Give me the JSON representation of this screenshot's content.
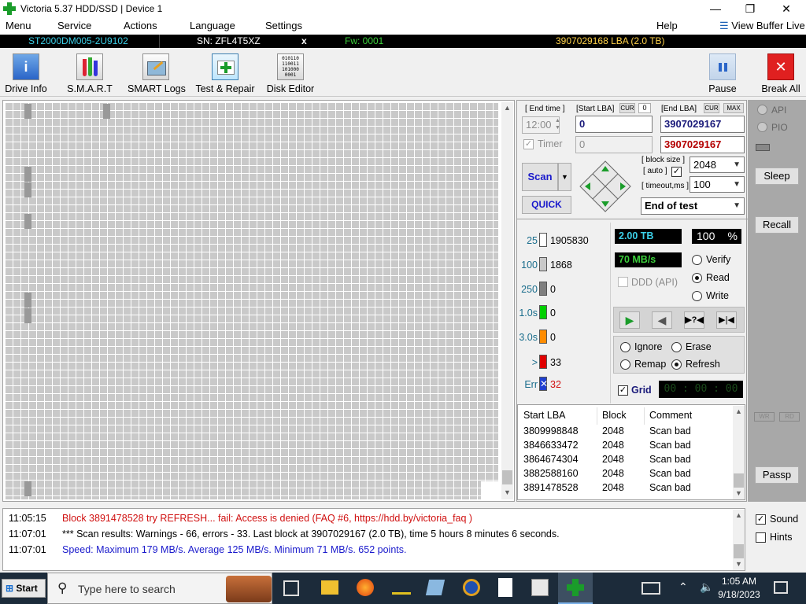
{
  "window": {
    "title": "Victoria 5.37 HDD/SSD | Device 1",
    "controls": {
      "minimize": "—",
      "maximize": "❐",
      "close": "✕"
    }
  },
  "menu": {
    "items": [
      "Menu",
      "Service",
      "Actions",
      "Language",
      "Settings"
    ],
    "help": "Help",
    "view_buffer": "View Buffer Live"
  },
  "drive_strip": {
    "model": "ST2000DM005-2U9102",
    "serial": "SN: ZFL4T5XZ",
    "close": "x",
    "firmware": "Fw: 0001",
    "capacity": "3907029168 LBA (2.0 TB)"
  },
  "toolbar": {
    "drive_info": "Drive Info",
    "smart": "S.M.A.R.T",
    "smart_logs": "SMART Logs",
    "test_repair": "Test & Repair",
    "disk_editor": "Disk Editor",
    "pause": "Pause",
    "break_all": "Break All"
  },
  "scan": {
    "end_time_label": "[ End time ]",
    "end_time_value": "12:00",
    "start_lba_label": "[Start LBA]",
    "cur_label": "CUR",
    "start_cur_value": "0",
    "end_lba_label": "[End LBA]",
    "max_label": "MAX",
    "start_lba_value": "0",
    "end_lba_value": "3907029167",
    "timer_label": "Timer",
    "timer_value": "0",
    "end_lba_value2": "3907029167",
    "block_size_label": "[ block size ]",
    "auto_label": "[ auto ]",
    "block_size_value": "2048",
    "timeout_label": "[ timeout,ms ]",
    "timeout_value": "100",
    "scan_button": "Scan",
    "quick_button": "QUICK",
    "end_action": "End of test"
  },
  "stats": {
    "rows": [
      {
        "label": "25",
        "value": "1905830",
        "color": "#ffffff"
      },
      {
        "label": "100",
        "value": "1868",
        "color": "#c8c8c8"
      },
      {
        "label": "250",
        "value": "0",
        "color": "#7f7f7f"
      },
      {
        "label": "1.0s",
        "value": "0",
        "color": "#00d000"
      },
      {
        "label": "3.0s",
        "value": "0",
        "color": "#ff8c00"
      },
      {
        "label": ">",
        "value": "33",
        "color": "#e00000"
      },
      {
        "label": "Err",
        "value": "32",
        "color": "#1f3fd0"
      }
    ],
    "size_display": "2.00 TB",
    "percent": "100",
    "percent_sign": "%",
    "speed_display": "70 MB/s",
    "ddd_label": "DDD (API)"
  },
  "mode": {
    "verify": "Verify",
    "read": "Read",
    "write": "Write",
    "selected": "Read"
  },
  "repair": {
    "ignore": "Ignore",
    "erase": "Erase",
    "remap": "Remap",
    "refresh": "Refresh",
    "selected": "Refresh"
  },
  "grid_option": {
    "label": "Grid",
    "timer": "00 : 00 : 00"
  },
  "table": {
    "headers": [
      "Start LBA",
      "Block",
      "Comment"
    ],
    "rows": [
      [
        "3809998848",
        "2048",
        "Scan bad"
      ],
      [
        "3846633472",
        "2048",
        "Scan bad"
      ],
      [
        "3864674304",
        "2048",
        "Scan bad"
      ],
      [
        "3882588160",
        "2048",
        "Scan bad"
      ],
      [
        "3891478528",
        "2048",
        "Scan bad"
      ]
    ]
  },
  "side": {
    "api": "API",
    "pio": "PIO",
    "sleep": "Sleep",
    "recall": "Recall",
    "wr": "WR",
    "rd": "RD",
    "passp": "Passp"
  },
  "log": [
    {
      "time": "11:05:15",
      "text": "Block 3891478528 try REFRESH... fail: Access is denied (FAQ #6, https://hdd.by/victoria_faq )",
      "color": "#d01010"
    },
    {
      "time": "11:07:01",
      "text": "*** Scan results: Warnings - 66, errors - 33. Last block at 3907029167 (2.0 TB), time 5 hours 8 minutes 6 seconds.",
      "color": "#000000"
    },
    {
      "time": "11:07:01",
      "text": "Speed: Maximum 179 MB/s. Average 125 MB/s. Minimum 71 MB/s. 652 points.",
      "color": "#1a1acc"
    }
  ],
  "log_options": {
    "sound": "Sound",
    "hints": "Hints"
  },
  "taskbar": {
    "start": "Start",
    "search_placeholder": "Type here to search",
    "time": "1:05 AM",
    "date": "9/18/2023"
  }
}
